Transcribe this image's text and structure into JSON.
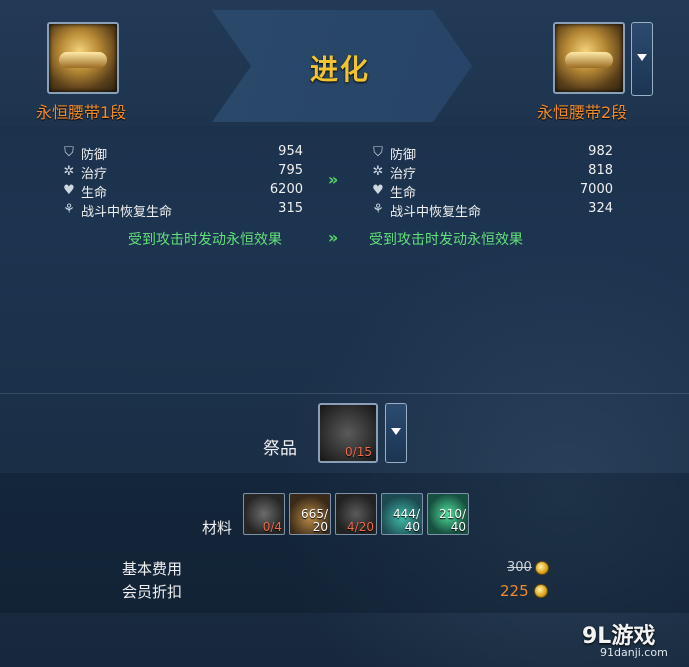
{
  "header": {
    "title": "进化",
    "source_item": {
      "name": "永恒腰带1段",
      "icon": "belt-icon"
    },
    "target_item": {
      "name": "永恒腰带2段",
      "icon": "belt-icon"
    }
  },
  "stats": {
    "rows": [
      {
        "icon": "shield-icon",
        "label": "防御",
        "before": "954",
        "after": "982"
      },
      {
        "icon": "heal-icon",
        "label": "治疗",
        "before": "795",
        "after": "818"
      },
      {
        "icon": "heart-icon",
        "label": "生命",
        "before": "6200",
        "after": "7000"
      },
      {
        "icon": "sprout-icon",
        "label": "战斗中恢复生命",
        "before": "315",
        "after": "324"
      }
    ],
    "arrow": "»",
    "effect_before": "受到攻击时发动永恒效果",
    "effect_after": "受到攻击时发动永恒效果"
  },
  "offering": {
    "label": "祭品",
    "count": "0/15"
  },
  "materials": {
    "label": "材料",
    "items": [
      {
        "count": "0/4",
        "state": "insufficient"
      },
      {
        "count": "665/\n20",
        "state": "ok"
      },
      {
        "count": "4/20",
        "state": "insufficient"
      },
      {
        "count": "444/\n40",
        "state": "ok"
      },
      {
        "count": "210/\n40",
        "state": "ok"
      }
    ]
  },
  "cost": {
    "base_label": "基本费用",
    "base_value": "300",
    "member_label": "会员折扣",
    "member_value": "225"
  },
  "watermark": {
    "brand": "9L游戏",
    "url": "91danji.com"
  },
  "colors": {
    "title": "#f2c431",
    "item_name": "#f08a2a",
    "effect": "#62e07a",
    "insufficient": "#ee6a4a"
  }
}
